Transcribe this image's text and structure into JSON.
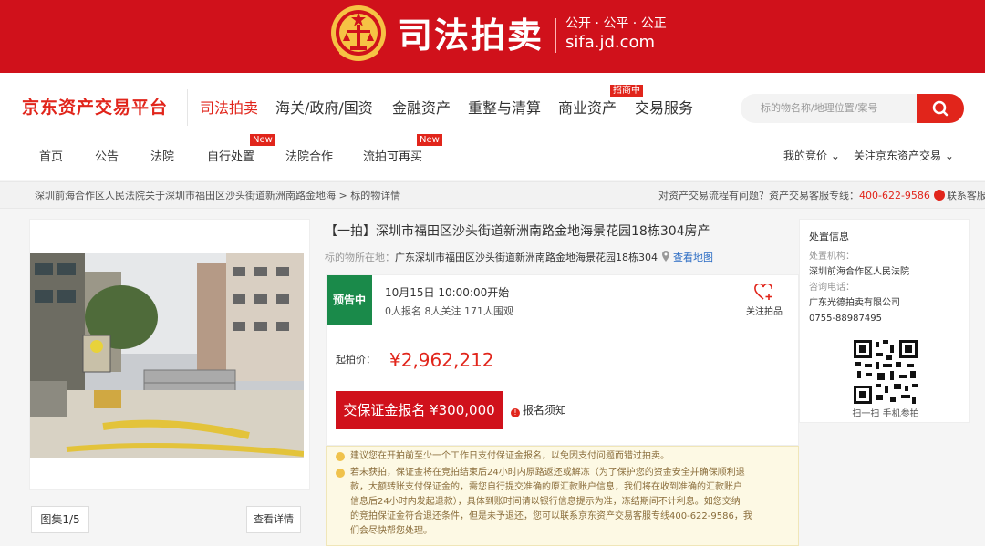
{
  "banner": {
    "title": "司法拍卖",
    "slogan": "公开 · 公平 · 公正",
    "url": "sifa.jd.com"
  },
  "header": {
    "logo": "京东资产交易平台",
    "main_nav": [
      "司法拍卖",
      "海关/政府/国资",
      "金融资产",
      "重整与清算",
      "商业资产",
      "交易服务"
    ],
    "recruit_tag": "招商中",
    "search_placeholder": "标的物名称/地理位置/案号",
    "sub_nav": [
      "首页",
      "公告",
      "法院",
      "自行处置",
      "法院合作",
      "流拍可再买"
    ],
    "new_tag": "New",
    "my_bids": "我的竞价",
    "follow_platform": "关注京东资产交易"
  },
  "breadcrumb": {
    "court_path": "深圳前海合作区人民法院关于深圳市福田区沙头街道新洲南路金地海",
    "sep": ">",
    "current": "标的物详情",
    "help_text": "对资产交易流程有问题？资产交易客服专线：",
    "phone": "400-622-9586",
    "contact": "联系客服"
  },
  "gallery": {
    "counter": "图集1/5",
    "detail_button": "查看详情"
  },
  "lot": {
    "title": "【一拍】深圳市福田区沙头街道新洲南路金地海景花园18栋304房产",
    "location_label": "标的物所在地：",
    "location": "广东深圳市福田区沙头街道新洲南路金地海景花园18栋304",
    "map_link": "查看地图",
    "status": "预告中",
    "start_time": "10月15日 10:00:00开始",
    "counts": "0人报名  8人关注  171人围观",
    "follow_label": "关注拍品",
    "price_label": "起拍价：",
    "price": "¥2,962,212",
    "deposit_button": "交保证金报名 ¥300,000",
    "notice_link": "报名须知",
    "tip1": "建议您在开拍前至少一个工作日支付保证金报名，以免因支付问题而错过拍卖。",
    "tip2_lines": [
      "若未获拍，保证金将在竞拍结束后24小时内原路返还或解冻（为了保护您的资金安全并确保顺利退",
      "款，大额转账支付保证金的，需您自行提交准确的原汇款账户信息，我们将在收到准确的汇款账户",
      "信息后24小时内发起退款），具体到账时间请以银行信息提示为准，冻结期间不计利息。如您交纳",
      "的竞拍保证金符合退还条件，但是未予退还，您可以联系京东资产交易客服专线400-622-9586，我",
      "们会尽快帮您处理。"
    ]
  },
  "side": {
    "heading": "处置信息",
    "org_label": "处置机构：",
    "org": "深圳前海合作区人民法院",
    "phone_label": "咨询电话：",
    "company": "广东光德拍卖有限公司",
    "phone": "0755-88987495",
    "qr_label": "扫一扫 手机参拍"
  },
  "colors": {
    "brand_red": "#d0111b",
    "status_green": "#1a8a4a",
    "tip_bg": "#fdf9e4"
  }
}
